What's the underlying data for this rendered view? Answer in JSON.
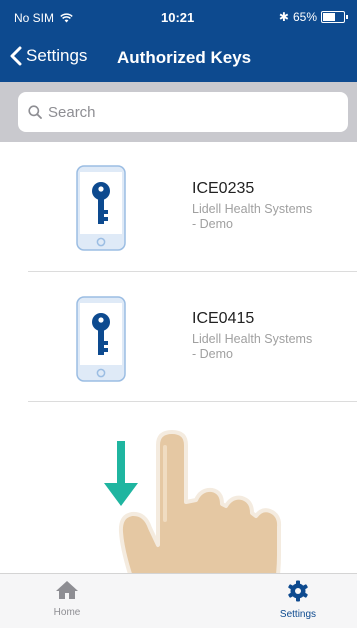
{
  "status_bar": {
    "carrier": "No SIM",
    "time": "10:21",
    "bluetooth": "✱",
    "battery_percent": "65%",
    "battery_level": 0.65
  },
  "nav": {
    "back_label": "Settings",
    "title": "Authorized Keys"
  },
  "search": {
    "placeholder": "Search"
  },
  "keys": [
    {
      "id": "ICE0235",
      "org_line1": "Lidell Health Systems",
      "org_line2": "- Demo"
    },
    {
      "id": "ICE0415",
      "org_line1": "Lidell Health Systems",
      "org_line2": "- Demo"
    }
  ],
  "tabbar": {
    "home_label": "Home",
    "settings_label": "Settings"
  },
  "colors": {
    "brand": "#0d4a8f",
    "arrow": "#1fb5a0",
    "hand": "#e5c8a3"
  }
}
